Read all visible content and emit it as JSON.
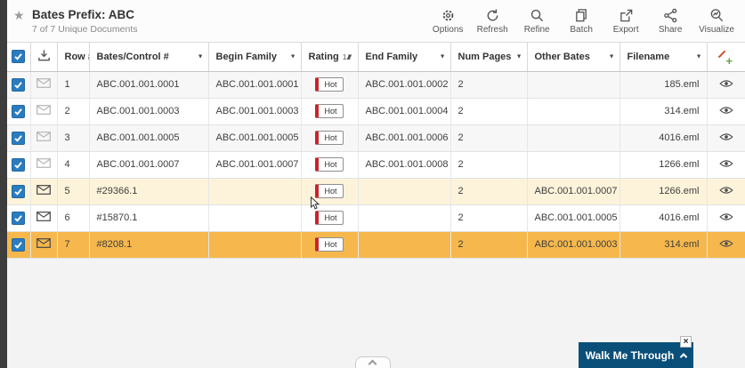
{
  "page": {
    "title": "Bates Prefix: ABC",
    "subtitle": "7 of 7 Unique Documents"
  },
  "toolbar": {
    "items": [
      {
        "label": "Options",
        "icon": "gear-icon"
      },
      {
        "label": "Refresh",
        "icon": "refresh-icon"
      },
      {
        "label": "Refine",
        "icon": "magnifier-icon"
      },
      {
        "label": "Batch",
        "icon": "batch-icon"
      },
      {
        "label": "Export",
        "icon": "export-icon"
      },
      {
        "label": "Share",
        "icon": "share-icon"
      },
      {
        "label": "Visualize",
        "icon": "visualize-icon"
      }
    ]
  },
  "table": {
    "headers": {
      "row": "Row #",
      "bates": "Bates/Control #",
      "begin_family": "Begin Family",
      "rating": "Rating",
      "rating_sort": "1▴",
      "end_family": "End Family",
      "num_pages": "Num Pages",
      "other_bates": "Other Bates",
      "filename": "Filename"
    },
    "rows": [
      {
        "row_num": "1",
        "bates": "ABC.001.001.0001",
        "begin_family": "ABC.001.001.0001",
        "rating": "Hot",
        "end_family": "ABC.001.001.0002",
        "num_pages": "2",
        "other_bates": "",
        "filename": "185.eml",
        "checked": true,
        "highlight": "none",
        "env": "light"
      },
      {
        "row_num": "2",
        "bates": "ABC.001.001.0003",
        "begin_family": "ABC.001.001.0003",
        "rating": "Hot",
        "end_family": "ABC.001.001.0004",
        "num_pages": "2",
        "other_bates": "",
        "filename": "314.eml",
        "checked": true,
        "highlight": "none",
        "env": "light"
      },
      {
        "row_num": "3",
        "bates": "ABC.001.001.0005",
        "begin_family": "ABC.001.001.0005",
        "rating": "Hot",
        "end_family": "ABC.001.001.0006",
        "num_pages": "2",
        "other_bates": "",
        "filename": "4016.eml",
        "checked": true,
        "highlight": "none",
        "env": "light"
      },
      {
        "row_num": "4",
        "bates": "ABC.001.001.0007",
        "begin_family": "ABC.001.001.0007",
        "rating": "Hot",
        "end_family": "ABC.001.001.0008",
        "num_pages": "2",
        "other_bates": "",
        "filename": "1266.eml",
        "checked": true,
        "highlight": "none",
        "env": "light"
      },
      {
        "row_num": "5",
        "bates": "#29366.1",
        "begin_family": "",
        "rating": "Hot",
        "end_family": "",
        "num_pages": "2",
        "other_bates": "ABC.001.001.0007",
        "filename": "1266.eml",
        "checked": true,
        "highlight": "cream",
        "env": "dark"
      },
      {
        "row_num": "6",
        "bates": "#15870.1",
        "begin_family": "",
        "rating": "Hot",
        "end_family": "",
        "num_pages": "2",
        "other_bates": "ABC.001.001.0005",
        "filename": "4016.eml",
        "checked": true,
        "highlight": "none",
        "env": "dark"
      },
      {
        "row_num": "7",
        "bates": "#8208.1",
        "begin_family": "",
        "rating": "Hot",
        "end_family": "",
        "num_pages": "2",
        "other_bates": "ABC.001.001.0003",
        "filename": "314.eml",
        "checked": true,
        "highlight": "orange",
        "env": "dark"
      }
    ]
  },
  "walkme": {
    "label": "Walk Me Through",
    "close_label": "×"
  },
  "colors": {
    "accent_blue": "#2a7cbe",
    "hot_red": "#c5262c",
    "highlight_cream": "#fcf3da",
    "highlight_orange": "#f6b84c",
    "walkme_blue": "#0a4f79",
    "sidebar_strip": "#3d3d3d"
  }
}
